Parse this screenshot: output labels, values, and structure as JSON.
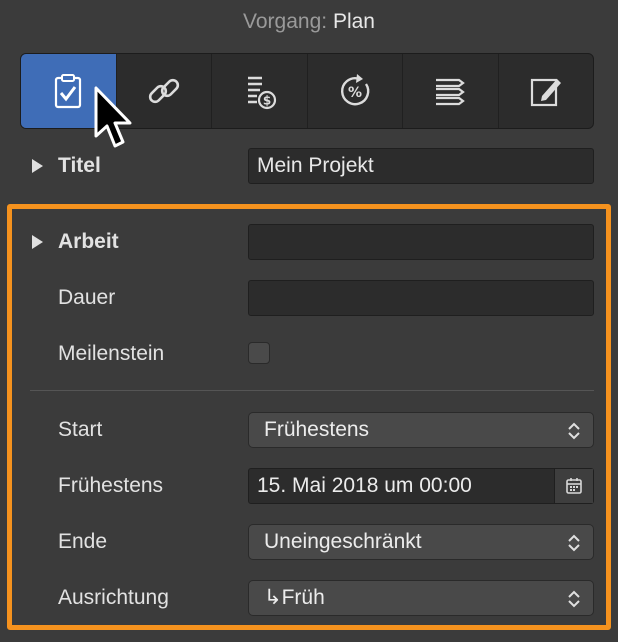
{
  "header": {
    "label": "Vorgang:",
    "value": "Plan"
  },
  "toolbar": {
    "tools": [
      {
        "icon": "clipboard-check-icon",
        "active": true
      },
      {
        "icon": "link-icon",
        "active": false
      },
      {
        "icon": "cost-icon",
        "active": false
      },
      {
        "icon": "percent-progress-icon",
        "active": false
      },
      {
        "icon": "list-icon",
        "active": false
      },
      {
        "icon": "edit-icon",
        "active": false
      }
    ]
  },
  "titel": {
    "label": "Titel",
    "value": "Mein Projekt"
  },
  "arbeit": {
    "label": "Arbeit",
    "value": ""
  },
  "dauer": {
    "label": "Dauer",
    "value": ""
  },
  "meilenstein": {
    "label": "Meilenstein",
    "checked": false
  },
  "start": {
    "label": "Start",
    "value": "Frühestens"
  },
  "fruehestens": {
    "label": "Frühestens",
    "value": "15. Mai 2018 um 00:00"
  },
  "ende": {
    "label": "Ende",
    "value": "Uneingeschränkt"
  },
  "ausrichtung": {
    "label": "Ausrichtung",
    "value": "↳Früh"
  },
  "colors": {
    "accent": "#3f6db7",
    "highlight": "#f5921e"
  }
}
